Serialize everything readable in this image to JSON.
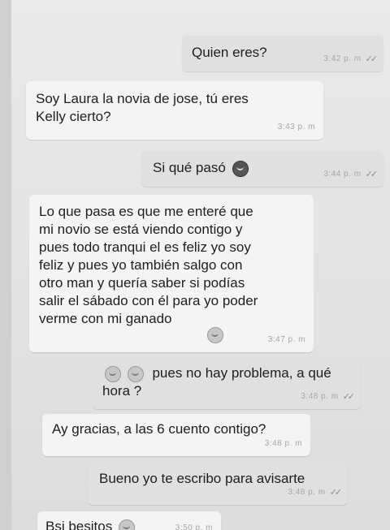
{
  "messages": [
    {
      "dir": "out",
      "text": "Quien eres?",
      "time": "3:42 p. m",
      "ticks": "✓✓"
    },
    {
      "dir": "in",
      "text": "Soy Laura la novia de jose, tú eres\nKelly cierto?",
      "time": "3:43 p. m"
    },
    {
      "dir": "out",
      "text": "Si qué pasó",
      "time": "3:44 p. m",
      "ticks": "✓✓",
      "emoji": "shocked-face"
    },
    {
      "dir": "in",
      "text": "Lo que pasa es que me enteré que\nmi novio se está viendo contigo y\npues todo tranqui el es feliz yo soy\nfeliz y pues yo también salgo con\notro man y quería saber si podías\nsalir el sábado con él para yo poder\nverme con mi ganado",
      "time": "3:47 p. m",
      "emoji": "laughing-face"
    },
    {
      "dir": "out",
      "text": "pues no hay problema, a qué\nhora ?",
      "time": "3:48 p. m",
      "ticks": "✓✓",
      "emoji": "laughing-faces"
    },
    {
      "dir": "in",
      "text": "Ay gracias, a las 6 cuento contigo?",
      "time": "3:48 p. m"
    },
    {
      "dir": "out",
      "text": "Bueno yo te escribo para avisarte",
      "time": "3:48 p. m",
      "ticks": "✓✓"
    },
    {
      "dir": "in",
      "text": "Bsi besitos",
      "time": "3:50 p. m",
      "emoji": "kiss-face"
    }
  ]
}
